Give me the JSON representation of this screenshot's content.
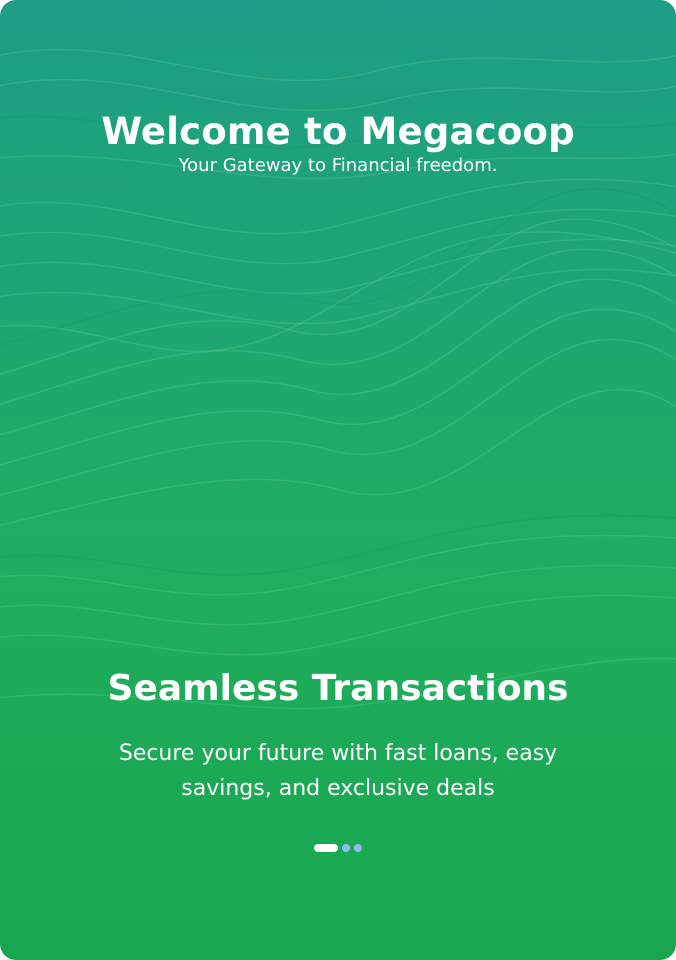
{
  "welcome": {
    "title": "Welcome to Megacoop",
    "subtitle": "Your Gateway to Financial freedom."
  },
  "carousel": {
    "slide_title": "Seamless Transactions",
    "slide_text": "Secure your future with fast loans, easy savings, and exclusive deals",
    "current_slide": 1,
    "total_slides": 3
  },
  "colors": {
    "background_top": "#1e9e86",
    "background_bottom": "#19a64f",
    "text": "#ffffff",
    "dot_active": "#ffffff",
    "dot_inactive": "#8fb8f4"
  }
}
